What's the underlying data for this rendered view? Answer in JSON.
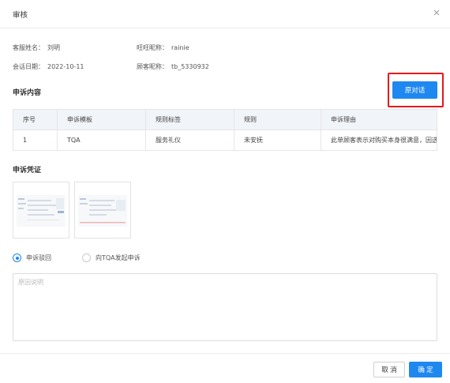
{
  "dialog": {
    "title": "审核",
    "close_icon": "close-icon"
  },
  "info": {
    "customer_service_label": "客服姓名：",
    "customer_service_value": "刘明",
    "wangwang_label": "旺旺昵称：",
    "wangwang_value": "rainie",
    "session_date_label": "会话日期：",
    "session_date_value": "2022-10-11",
    "customer_nick_label": "顾客昵称：",
    "customer_nick_value": "tb_5330932"
  },
  "appeal_content": {
    "title": "申诉内容",
    "original_dialog_button": "原对话",
    "table": {
      "headers": [
        "序号",
        "申诉模板",
        "规则标签",
        "规则",
        "申诉理由"
      ],
      "rows": [
        [
          "1",
          "TQA",
          "服务礼仪",
          "未安抚",
          "此单顾客表示对购买本身很满意，因选购"
        ]
      ]
    }
  },
  "appeal_evidence": {
    "title": "申诉凭证",
    "thumbnails": [
      "screenshot-thumbnail",
      "screenshot-thumbnail"
    ]
  },
  "appeal_options": {
    "options": [
      {
        "label": "申诉驳回",
        "checked": true
      },
      {
        "label": "向TQA发起申诉",
        "checked": false
      }
    ]
  },
  "reason": {
    "placeholder": "原因说明",
    "value": ""
  },
  "footer": {
    "cancel_label": "取 消",
    "confirm_label": "确 定"
  },
  "colors": {
    "primary": "#1e88f0",
    "highlight": "#e9181b",
    "table_header_bg": "#f1f4f8"
  }
}
